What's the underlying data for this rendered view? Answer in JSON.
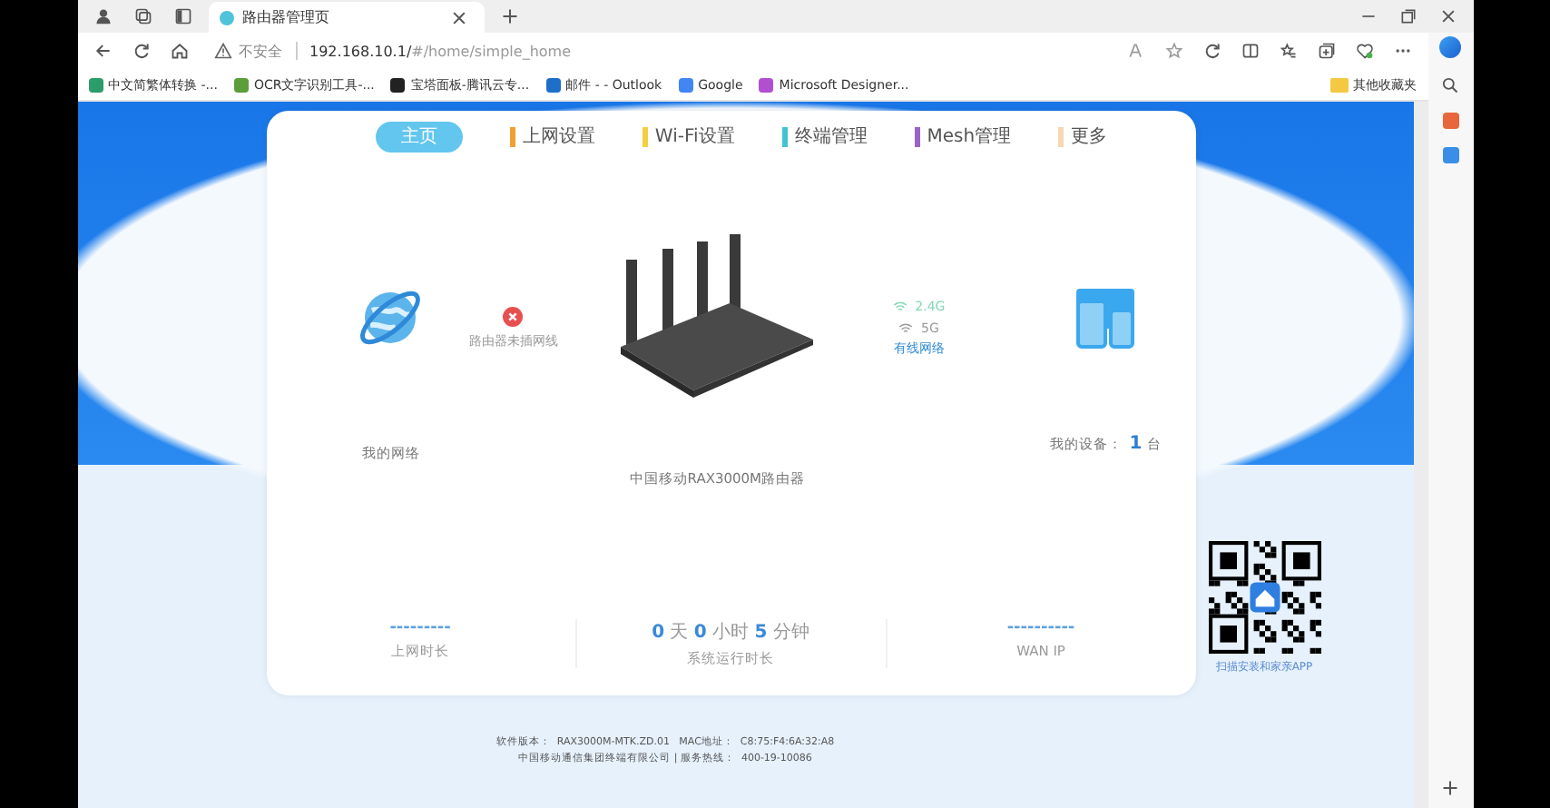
{
  "browser": {
    "tab_title": "路由器管理页",
    "security": "不安全",
    "url_host": "192.168.10.1/",
    "url_path": "#/home/simple_home",
    "bookmarks": [
      "中文简繁体转换 -...",
      "OCR文字识别工具-...",
      "宝塔面板-腾讯云专...",
      "邮件 - - Outlook",
      "Google",
      "Microsoft Designer..."
    ],
    "other_bookmarks": "其他收藏夹"
  },
  "nav": [
    {
      "label": "主页",
      "selected": true,
      "color": "#62c6ee"
    },
    {
      "label": "上网设置",
      "selected": false,
      "color": "#f0a030"
    },
    {
      "label": "Wi-Fi设置",
      "selected": false,
      "color": "#f2d040"
    },
    {
      "label": "终端管理",
      "selected": false,
      "color": "#40c4d0"
    },
    {
      "label": "Mesh管理",
      "selected": false,
      "color": "#9a64c4"
    },
    {
      "label": "更多",
      "selected": false,
      "color": "#f6d8b0"
    }
  ],
  "topology": {
    "network_label": "我的网络",
    "wan_status": "路由器未插网线",
    "router_label": "中国移动RAX3000M路由器",
    "bands": [
      {
        "label": "2.4G",
        "on": true
      },
      {
        "label": "5G",
        "on": false
      }
    ],
    "wired": "有线网络",
    "devices_label": "我的设备：",
    "devices_count": "1",
    "devices_unit": "台"
  },
  "stats": [
    {
      "kind": "dashes",
      "value": "---------",
      "label": "上网时长"
    },
    {
      "kind": "uptime",
      "parts": [
        {
          "num": "0",
          "unit": "天"
        },
        {
          "num": "0",
          "unit": "小时"
        },
        {
          "num": "5",
          "unit": "分钟"
        }
      ],
      "label": "系统运行时长"
    },
    {
      "kind": "dashes",
      "value": "----------",
      "label": "WAN IP"
    }
  ],
  "qr_label": "扫描安装和家亲APP",
  "footer": [
    "软件版本：  RAX3000M-MTK.ZD.01   MAC地址：  C8:75:F4:6A:32:A8",
    "中国移动通信集团终端有限公司 | 服务热线：  400-19-10086"
  ]
}
